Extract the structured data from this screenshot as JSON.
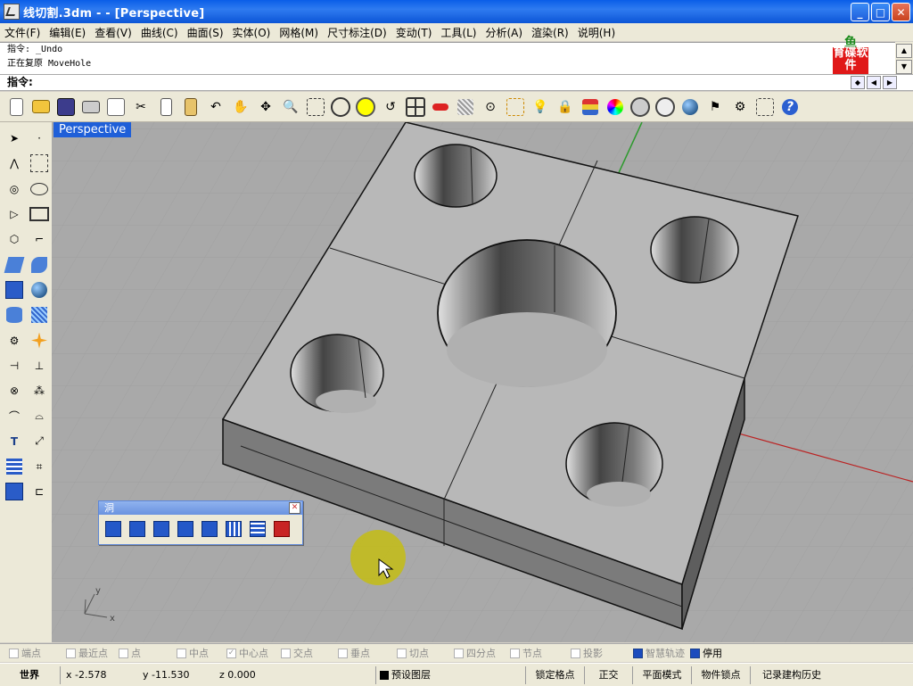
{
  "window": {
    "title": "线切割.3dm -  - [Perspective]",
    "buttons": [
      "_",
      "□",
      "✕"
    ]
  },
  "menu": [
    "文件(F)",
    "编辑(E)",
    "查看(V)",
    "曲线(C)",
    "曲面(S)",
    "实体(O)",
    "网格(M)",
    "尺寸标注(D)",
    "变动(T)",
    "工具(L)",
    "分析(A)",
    "渲染(R)",
    "说明(H)"
  ],
  "command": {
    "history": [
      "指令: _Undo",
      "正在复原 MoveHole"
    ],
    "prompt": "指令:"
  },
  "logo": {
    "top": "鱼",
    "text": "育碟软件"
  },
  "viewport": {
    "label": "Perspective",
    "axis_x": "x",
    "axis_y": "y"
  },
  "palette": {
    "title": "洞",
    "close": "✕"
  },
  "osnaps": [
    {
      "label": "端点",
      "checked": false
    },
    {
      "label": "最近点",
      "checked": false
    },
    {
      "label": "点",
      "checked": false
    },
    {
      "label": "中点",
      "checked": false
    },
    {
      "label": "中心点",
      "checked": true
    },
    {
      "label": "交点",
      "checked": false
    },
    {
      "label": "垂点",
      "checked": false
    },
    {
      "label": "切点",
      "checked": false
    },
    {
      "label": "四分点",
      "checked": false
    },
    {
      "label": "节点",
      "checked": false
    },
    {
      "label": "投影",
      "checked": false
    },
    {
      "label": "智慧轨迹",
      "checked": true
    },
    {
      "label": "停用",
      "checked": true
    }
  ],
  "status": {
    "world": "世界",
    "x": "x -2.578",
    "y": "y -11.530",
    "z": "z 0.000",
    "layer": "预设图层",
    "grid_lock": "锁定格点",
    "ortho": "正交",
    "planar": "平面模式",
    "object_snap": "物件锁点",
    "history": "记录建构历史"
  }
}
